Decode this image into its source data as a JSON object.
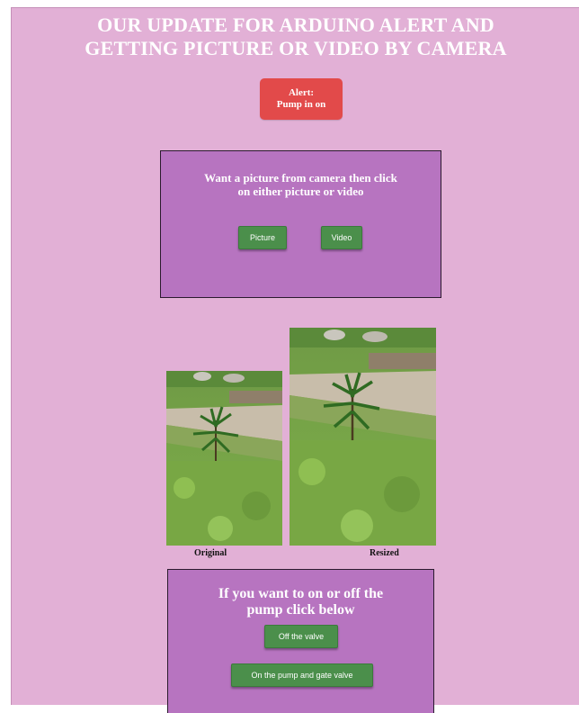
{
  "header": {
    "title_line1": "OUR UPDATE FOR ARDUINO ALERT AND",
    "title_line2": "GETTING PICTURE OR VIDEO BY CAMERA"
  },
  "alert": {
    "line1": "Alert:",
    "line2": "Pump in on",
    "color": "#e24a4a"
  },
  "camera_panel": {
    "heading_line1": "Want a picture from camera then click",
    "heading_line2": "on either picture or video",
    "picture_label": "Picture",
    "video_label": "Video"
  },
  "images": {
    "original_caption": "Original",
    "resized_caption": "Resized"
  },
  "pump_panel": {
    "heading_line1": "If you want to on or off the",
    "heading_line2": "pump click below",
    "off_label": "Off the valve",
    "on_label": "On the pump and gate valve"
  },
  "colors": {
    "page_background": "#e2b0d6",
    "panel_background": "#b774c0",
    "button_green": "#4b8f4b"
  }
}
